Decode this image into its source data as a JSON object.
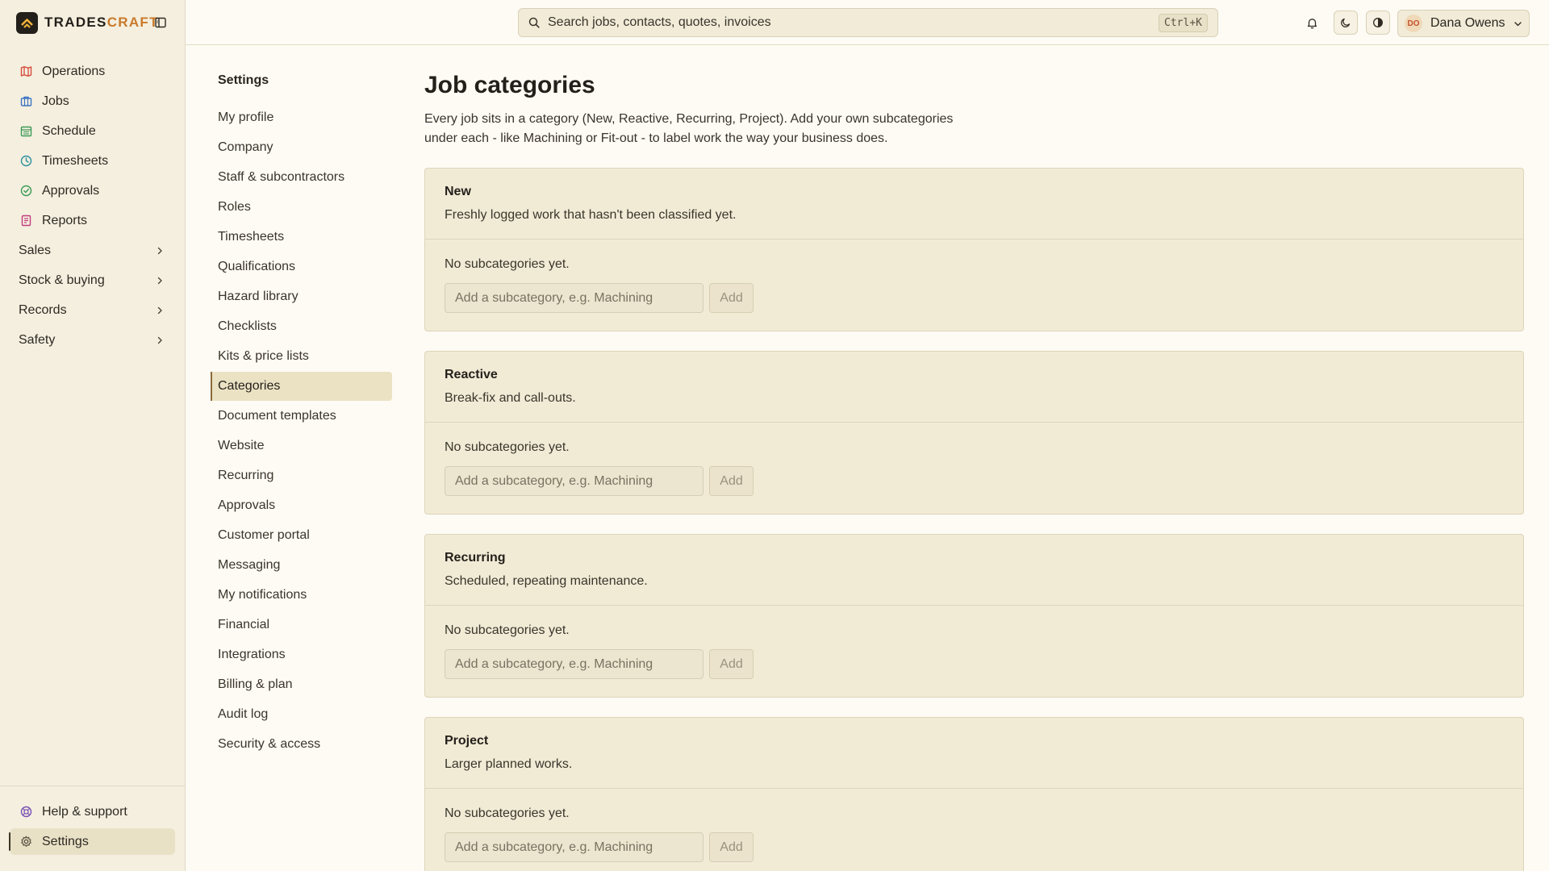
{
  "brand": {
    "name_main": "TRADES",
    "name_accent": "CRAFT"
  },
  "sidebar": {
    "items": [
      {
        "label": "Operations",
        "icon": "map-icon",
        "color": "#d44b3a"
      },
      {
        "label": "Jobs",
        "icon": "briefcase-icon",
        "color": "#3b74c4"
      },
      {
        "label": "Schedule",
        "icon": "calendar-icon",
        "color": "#3c9a56"
      },
      {
        "label": "Timesheets",
        "icon": "clock-icon",
        "color": "#2f8f9e"
      },
      {
        "label": "Approvals",
        "icon": "check-circle-icon",
        "color": "#3c9a56"
      },
      {
        "label": "Reports",
        "icon": "report-icon",
        "color": "#c43b7c"
      }
    ],
    "groups": [
      {
        "label": "Sales"
      },
      {
        "label": "Stock & buying"
      },
      {
        "label": "Records"
      },
      {
        "label": "Safety"
      }
    ],
    "bottom": [
      {
        "label": "Help & support",
        "icon": "life-ring-icon",
        "color": "#7a52b3"
      },
      {
        "label": "Settings",
        "icon": "gear-icon",
        "color": "#5a5343"
      }
    ]
  },
  "topbar": {
    "search_placeholder": "Search jobs, contacts, quotes, invoices",
    "search_shortcut": "Ctrl+K",
    "user": {
      "initials": "DO",
      "name": "Dana Owens"
    }
  },
  "settings": {
    "title": "Settings",
    "items": [
      "My profile",
      "Company",
      "Staff & subcontractors",
      "Roles",
      "Timesheets",
      "Qualifications",
      "Hazard library",
      "Checklists",
      "Kits & price lists",
      "Categories",
      "Document templates",
      "Website",
      "Recurring",
      "Approvals",
      "Customer portal",
      "Messaging",
      "My notifications",
      "Financial",
      "Integrations",
      "Billing & plan",
      "Audit log",
      "Security & access"
    ],
    "active": "Categories"
  },
  "main": {
    "title": "Job categories",
    "description": "Every job sits in a category (New, Reactive, Recurring, Project). Add your own subcategories under each - like Machining or Fit-out - to label work the way your business does.",
    "categories": [
      {
        "name": "New",
        "description": "Freshly logged work that hasn't been classified yet.",
        "empty_text": "No subcategories yet.",
        "placeholder": "Add a subcategory, e.g. Machining",
        "add_label": "Add"
      },
      {
        "name": "Reactive",
        "description": "Break-fix and call-outs.",
        "empty_text": "No subcategories yet.",
        "placeholder": "Add a subcategory, e.g. Machining",
        "add_label": "Add"
      },
      {
        "name": "Recurring",
        "description": "Scheduled, repeating maintenance.",
        "empty_text": "No subcategories yet.",
        "placeholder": "Add a subcategory, e.g. Machining",
        "add_label": "Add"
      },
      {
        "name": "Project",
        "description": "Larger planned works.",
        "empty_text": "No subcategories yet.",
        "placeholder": "Add a subcategory, e.g. Machining",
        "add_label": "Add"
      }
    ]
  }
}
